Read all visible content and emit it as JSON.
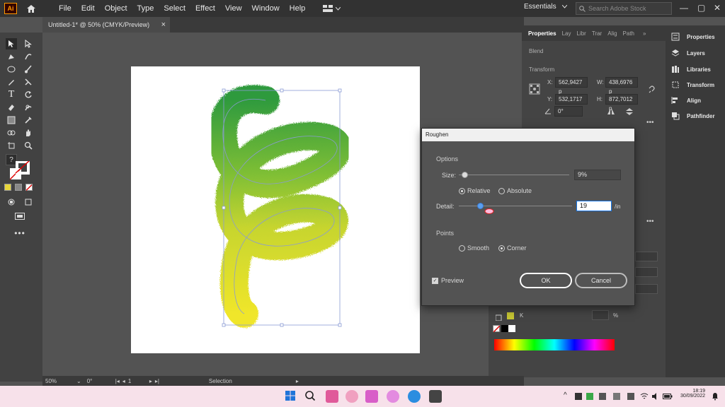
{
  "app": {
    "logo": "Ai",
    "menu": [
      "File",
      "Edit",
      "Object",
      "Type",
      "Select",
      "Effect",
      "View",
      "Window",
      "Help"
    ],
    "workspace": "Essentials",
    "search_placeholder": "Search Adobe Stock"
  },
  "document": {
    "tab_title": "Untitled-1* @ 50% (CMYK/Preview)"
  },
  "properties": {
    "tabs": [
      "Properties",
      "Lay",
      "Libr",
      "Trar",
      "Alig",
      "Path"
    ],
    "blend_label": "Blend",
    "transform_label": "Transform",
    "x_label": "X:",
    "x_value": "562,9427 p",
    "y_label": "Y:",
    "y_value": "532,1717 p",
    "w_label": "W:",
    "w_value": "438,6976 p",
    "h_label": "H:",
    "h_value": "872,7012 p",
    "angle_value": "0°"
  },
  "dock": {
    "items": [
      "Properties",
      "Layers",
      "Libraries",
      "Transform",
      "Align",
      "Pathfinder"
    ]
  },
  "color_panel": {
    "k_label": "K",
    "pct": "%"
  },
  "roughen": {
    "title": "Roughen",
    "options_label": "Options",
    "size_label": "Size:",
    "size_value": "9%",
    "size_fraction": 0.05,
    "relative_label": "Relative",
    "absolute_label": "Absolute",
    "detail_label": "Detail:",
    "detail_value": "19",
    "detail_unit": "/in",
    "detail_fraction": 0.19,
    "points_label": "Points",
    "smooth_label": "Smooth",
    "corner_label": "Corner",
    "preview_label": "Preview",
    "ok_label": "OK",
    "cancel_label": "Cancel"
  },
  "status": {
    "zoom": "50%",
    "rotation": "0°",
    "artboard_num": "1",
    "tool_name": "Selection"
  },
  "taskbar": {
    "time": "18:19",
    "date": "30/09/2022"
  },
  "colors": {
    "accent_blue": "#1473e6",
    "spiral_dark_green": "#2e9a3e",
    "spiral_lime": "#9fcb32",
    "spiral_yellow": "#f0e62a"
  }
}
